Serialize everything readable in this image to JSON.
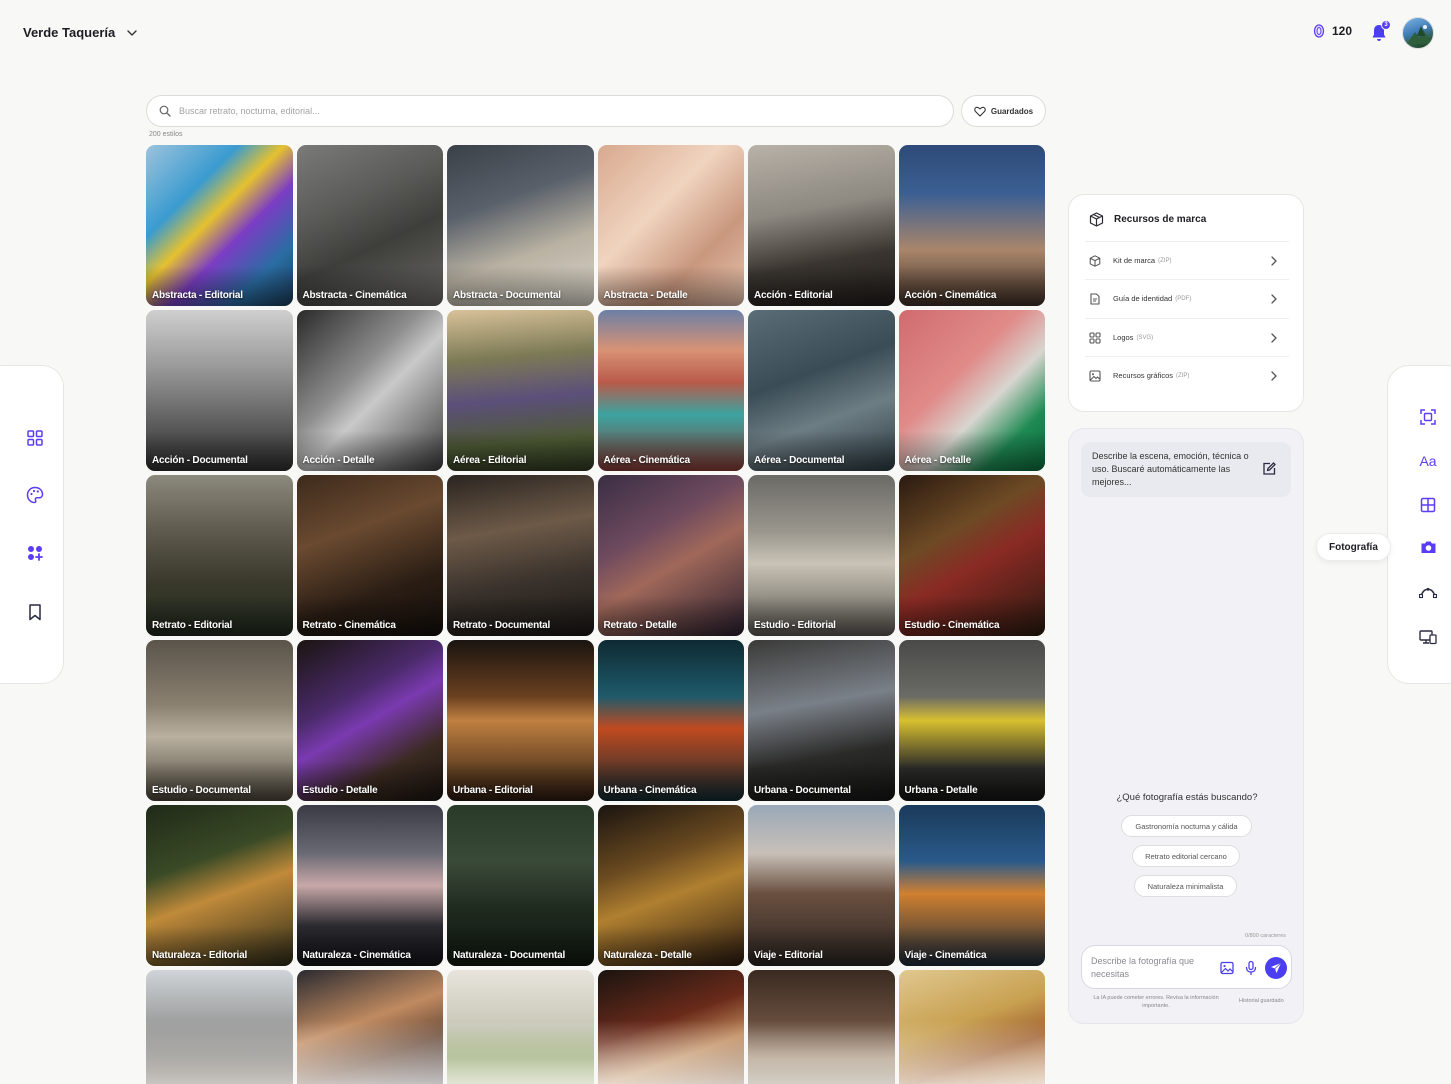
{
  "header": {
    "brand_name": "Verde Taquería",
    "credits": "120",
    "notifications_count": "3"
  },
  "search": {
    "placeholder": "Buscar retrato, nocturna, editorial...",
    "saved_label": "Guardados",
    "count_label": "200 estilos"
  },
  "grid": {
    "tiles": [
      {
        "label": "Abstracta - Editorial",
        "bg": "linear-gradient(135deg,#9cc3dd 0%,#3a9bd0 30%,#e6c12f 45%,#7b3dc4 60%,#2a6da3 80%,#1a3a58 100%)"
      },
      {
        "label": "Abstracta - Cinemática",
        "bg": "linear-gradient(155deg,#7a7a78 0%,#5b5b58 35%,#3e3e3b 60%,#6a6966 100%)"
      },
      {
        "label": "Abstracta - Documental",
        "bg": "linear-gradient(160deg,#3b4148 0%,#59606a 35%,#b9b2a3 65%,#d9d4c9 100%)"
      },
      {
        "label": "Abstracta - Detalle",
        "bg": "linear-gradient(135deg,#d8a98f 0%,#f0d4bf 40%,#c9977e 70%,#e7c3ad 100%)"
      },
      {
        "label": "Acción - Editorial",
        "bg": "linear-gradient(170deg,#b8b2a8 0%,#8d8880 40%,#3a3530 70%,#1f1b18 100%)"
      },
      {
        "label": "Acción - Cinemática",
        "bg": "linear-gradient(180deg,#2e4a78 0%,#3b5f93 30%,#a9866b 65%,#3f2f26 100%)"
      },
      {
        "label": "Acción - Documental",
        "bg": "linear-gradient(180deg,#cfcfcf 0%,#9a9a9a 35%,#5e5e5e 70%,#2f2f2f 100%)"
      },
      {
        "label": "Acción - Detalle",
        "bg": "linear-gradient(135deg,#2a2a2a 0%,#8d8d8d 40%,#c9c9c9 55%,#3a3a3a 100%)"
      },
      {
        "label": "Aérea - Editorial",
        "bg": "linear-gradient(175deg,#d9c29a 0%,#7c7a55 30%,#5c4f7a 55%,#4d5a34 80%,#2f3a22 100%)"
      },
      {
        "label": "Aérea - Cinemática",
        "bg": "linear-gradient(180deg,#6c7fa5 0%,#d99275 25%,#b85a4a 45%,#3ca3a0 65%,#8a3a33 100%)"
      },
      {
        "label": "Aérea - Documental",
        "bg": "linear-gradient(160deg,#5a6e78 0%,#3a4c55 40%,#6d7d84 65%,#2b3a40 100%)"
      },
      {
        "label": "Aérea - Detalle",
        "bg": "linear-gradient(135deg,#d06b6f 0%,#e08b89 40%,#d8d5cf 60%,#1e8a53 80%,#0f6b3c 100%)"
      },
      {
        "label": "Retrato - Editorial",
        "bg": "linear-gradient(180deg,#8c8a7c 0%,#5e5a4d 35%,#3b3a2c 65%,#1f2a1d 100%)"
      },
      {
        "label": "Retrato - Cinemática",
        "bg": "linear-gradient(160deg,#3d2a1c 0%,#6a4a30 35%,#2a1d14 70%,#140e0a 100%)"
      },
      {
        "label": "Retrato - Documental",
        "bg": "linear-gradient(170deg,#2a2420 0%,#6d5a48 35%,#3a322c 65%,#1a1714 100%)"
      },
      {
        "label": "Retrato - Detalle",
        "bg": "linear-gradient(150deg,#3a2e44 0%,#6e4a5e 35%,#a0685a 55%,#2a1f2e 100%)"
      },
      {
        "label": "Estudio - Editorial",
        "bg": "linear-gradient(180deg,#6a6a66 0%,#9a968d 35%,#c9c3b6 55%,#5a5650 100%)"
      },
      {
        "label": "Estudio - Cinemática",
        "bg": "linear-gradient(150deg,#2a1a10 0%,#6d4a25 35%,#8a2a24 55%,#2a1a10 100%)"
      },
      {
        "label": "Estudio - Documental",
        "bg": "linear-gradient(180deg,#5a544a 0%,#8a8070 40%,#b9b0a0 60%,#4a4438 100%)"
      },
      {
        "label": "Estudio - Detalle",
        "bg": "linear-gradient(150deg,#1a1410 0%,#4a2a6a 35%,#7a3ab0 50%,#3a2a20 75%,#1a1410 100%)"
      },
      {
        "label": "Urbana - Editorial",
        "bg": "linear-gradient(180deg,#1a1410 0%,#6a4020 35%,#c08040 50%,#2a1a10 100%)"
      },
      {
        "label": "Urbana - Cinemática",
        "bg": "linear-gradient(180deg,#0e2a33 0%,#1f5a6a 35%,#c04a20 55%,#102a30 100%)"
      },
      {
        "label": "Urbana - Documental",
        "bg": "linear-gradient(170deg,#3a3a38 0%,#7a8088 40%,#2a2a28 70%,#141414 100%)"
      },
      {
        "label": "Urbana - Detalle",
        "bg": "linear-gradient(180deg,#4a4a48 0%,#6a6a66 35%,#d8c030 50%,#2a2a28 80%,#141414 100%)"
      },
      {
        "label": "Naturaleza - Editorial",
        "bg": "linear-gradient(160deg,#1f2a18 0%,#3a4a26 35%,#c08a3a 55%,#2a2a18 100%)"
      },
      {
        "label": "Naturaleza - Cinemática",
        "bg": "linear-gradient(180deg,#3a3a44 0%,#6a6a74 30%,#c8a8a8 50%,#2a2a30 75%,#141418 100%)"
      },
      {
        "label": "Naturaleza - Documental",
        "bg": "linear-gradient(180deg,#2a3a28 0%,#3a4a38 35%,#1f2a1f 65%,#101810 100%)"
      },
      {
        "label": "Naturaleza - Detalle",
        "bg": "linear-gradient(160deg,#1a1410 0%,#6a4a20 35%,#b08030 55%,#2a1a10 100%)"
      },
      {
        "label": "Viaje - Editorial",
        "bg": "linear-gradient(180deg,#9aa8b8 0%,#c8c0b8 30%,#6a5040 55%,#2a2420 100%)"
      },
      {
        "label": "Viaje - Cinemática",
        "bg": "linear-gradient(180deg,#1a3a5a 0%,#2a5a8a 35%,#d08030 55%,#1a2a3a 100%)"
      },
      {
        "label": "",
        "bg": "linear-gradient(180deg,#d0d4d8 0%,#8a8a88 45%,#5a5048 70%,#3a3430 100%)"
      },
      {
        "label": "",
        "bg": "linear-gradient(160deg,#2a2a30 0%,#c08a60 35%,#6a4a38 55%,#1a2a4a 100%)"
      },
      {
        "label": "",
        "bg": "linear-gradient(180deg,#e8e4dc 0%,#c8c8b8 35%,#8aa060 55%,#e0dcd0 100%)"
      },
      {
        "label": "",
        "bg": "linear-gradient(160deg,#1a1410 0%,#6a2a1a 35%,#c08a5a 55%,#3a2418 100%)"
      },
      {
        "label": "",
        "bg": "linear-gradient(180deg,#3a2a20 0%,#6a5040 35%,#a08a70 55%,#4a3a2a 100%)"
      },
      {
        "label": "",
        "bg": "linear-gradient(160deg,#e0c890 0%,#c8a050 35%,#a06030 55%,#f0d8b0 100%)"
      }
    ]
  },
  "left_rail": {
    "icons": [
      "grid-icon",
      "palette-icon",
      "components-icon",
      "bookmark-icon"
    ],
    "accent": "#5b3df5"
  },
  "right_rail": {
    "icons": [
      "scan-icon",
      "typography-icon",
      "layout-icon",
      "camera-icon",
      "vector-icon",
      "devices-icon"
    ],
    "active_tooltip": "Fotografía",
    "typography_glyph": "Aa"
  },
  "brand_resources": {
    "title": "Recursos de marca",
    "items": [
      {
        "name": "Kit de marca",
        "type": "(ZIP)",
        "icon": "package-icon"
      },
      {
        "name": "Guía de identidad",
        "type": "(PDF)",
        "icon": "document-icon"
      },
      {
        "name": "Logos",
        "type": "(SVG)",
        "icon": "logos-icon"
      },
      {
        "name": "Recursos gráficos",
        "type": "(ZIP)",
        "icon": "image-icon"
      }
    ]
  },
  "assistant": {
    "description": "Describe la escena, emoción, técnica o uso. Buscaré automáticamente las mejores...",
    "question": "¿Qué fotografía estás buscando?",
    "suggestions": [
      "Gastronomía nocturna y cálida",
      "Retrato editorial cercano",
      "Naturaleza minimalista"
    ],
    "char_count": "0/800 caracteres",
    "input_placeholder": "Describe la fotografía que necesitas",
    "disclaimer": "La IA puede cometer errores. Revisa la información importante.",
    "history_link": "Historial guardado",
    "send_color": "#4b3ef0"
  }
}
